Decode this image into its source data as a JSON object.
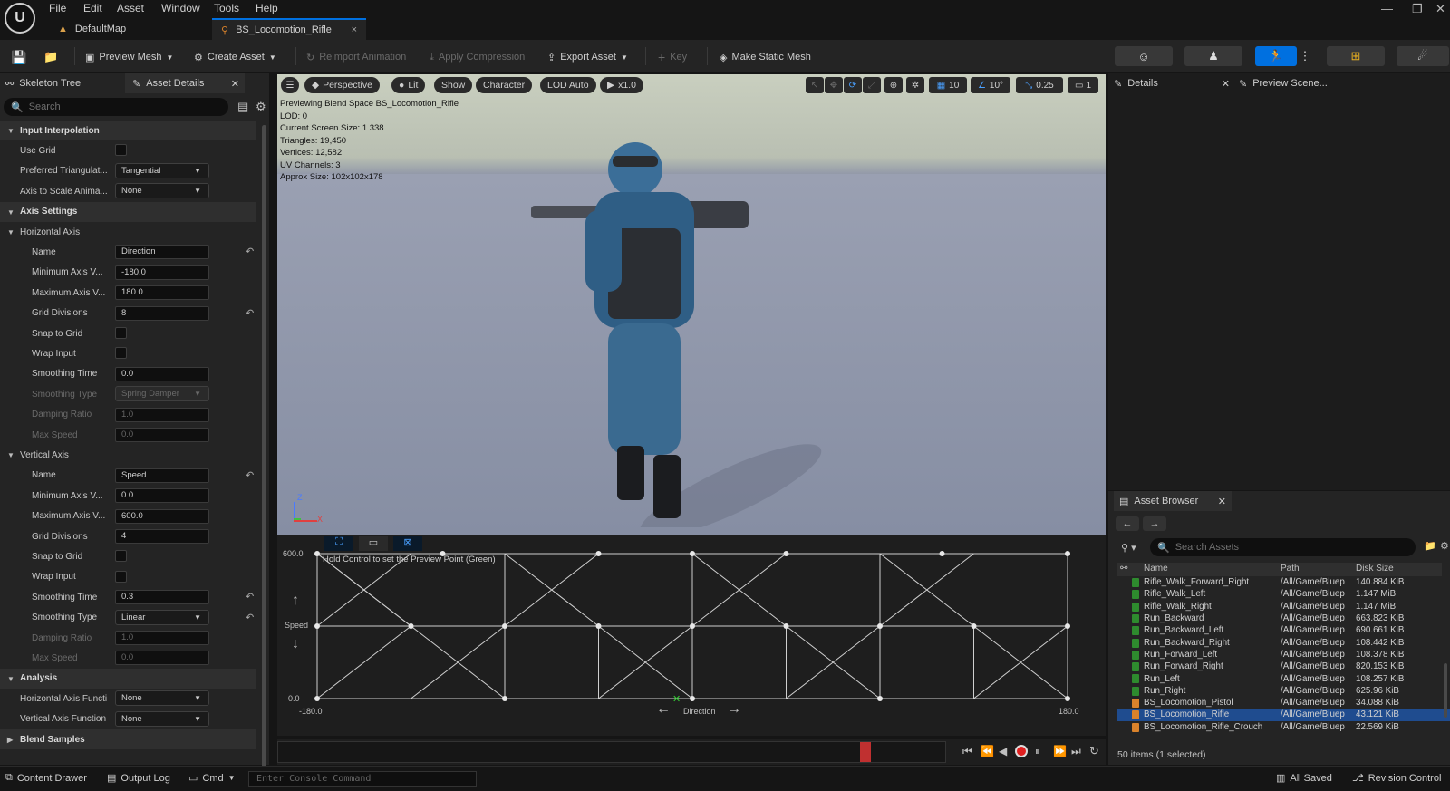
{
  "menu": {
    "items": [
      "File",
      "Edit",
      "Asset",
      "Window",
      "Tools",
      "Help"
    ]
  },
  "tabs": {
    "default_map": "DefaultMap",
    "active": "BS_Locomotion_Rifle",
    "close": "×"
  },
  "toolbar": {
    "preview_mesh": "Preview Mesh",
    "create_asset": "Create Asset",
    "reimport": "Reimport Animation",
    "apply_compression": "Apply Compression",
    "export_asset": "Export Asset",
    "key": "Key",
    "make_static_mesh": "Make Static Mesh"
  },
  "left_panel": {
    "tab_skeleton": "Skeleton Tree",
    "tab_asset_details": "Asset Details",
    "search_placeholder": "Search",
    "rows": [
      {
        "kind": "cat",
        "label": "Input Interpolation"
      },
      {
        "kind": "check",
        "label": "Use Grid"
      },
      {
        "kind": "dd",
        "label": "Preferred Triangulat...",
        "value": "Tangential"
      },
      {
        "kind": "dd",
        "label": "Axis to Scale Anima...",
        "value": "None"
      },
      {
        "kind": "cat",
        "label": "Axis Settings"
      },
      {
        "kind": "sub",
        "label": "Horizontal Axis"
      },
      {
        "kind": "text",
        "label": "Name",
        "value": "Direction",
        "reset": true
      },
      {
        "kind": "text",
        "label": "Minimum Axis V...",
        "value": "-180.0"
      },
      {
        "kind": "text",
        "label": "Maximum Axis V...",
        "value": "180.0"
      },
      {
        "kind": "text",
        "label": "Grid Divisions",
        "value": "8",
        "reset": true
      },
      {
        "kind": "check",
        "label": "Snap to Grid",
        "indent": true
      },
      {
        "kind": "check",
        "label": "Wrap Input",
        "indent": true
      },
      {
        "kind": "text",
        "label": "Smoothing Time",
        "value": "0.0"
      },
      {
        "kind": "dd",
        "label": "Smoothing Type",
        "value": "Spring Damper",
        "dim": true,
        "indent": true
      },
      {
        "kind": "text",
        "label": "Damping Ratio",
        "value": "1.0",
        "dim": true
      },
      {
        "kind": "text",
        "label": "Max Speed",
        "value": "0.0",
        "dim": true
      },
      {
        "kind": "sub",
        "label": "Vertical Axis"
      },
      {
        "kind": "text",
        "label": "Name",
        "value": "Speed",
        "reset": true
      },
      {
        "kind": "text",
        "label": "Minimum Axis V...",
        "value": "0.0"
      },
      {
        "kind": "text",
        "label": "Maximum Axis V...",
        "value": "600.0"
      },
      {
        "kind": "text",
        "label": "Grid Divisions",
        "value": "4"
      },
      {
        "kind": "check",
        "label": "Snap to Grid",
        "indent": true
      },
      {
        "kind": "check",
        "label": "Wrap Input",
        "indent": true
      },
      {
        "kind": "text",
        "label": "Smoothing Time",
        "value": "0.3",
        "reset": true
      },
      {
        "kind": "dd",
        "label": "Smoothing Type",
        "value": "Linear",
        "reset": true,
        "indent": true
      },
      {
        "kind": "text",
        "label": "Damping Ratio",
        "value": "1.0",
        "dim": true
      },
      {
        "kind": "text",
        "label": "Max Speed",
        "value": "0.0",
        "dim": true
      },
      {
        "kind": "cat",
        "label": "Analysis"
      },
      {
        "kind": "dd",
        "label": "Horizontal Axis Functi",
        "value": "None",
        "top": true
      },
      {
        "kind": "dd",
        "label": "Vertical Axis Function",
        "value": "None",
        "top": true
      },
      {
        "kind": "cat",
        "label": "Blend Samples",
        "collapsed": true
      }
    ]
  },
  "viewport": {
    "perspective": "Perspective",
    "lit": "Lit",
    "show": "Show",
    "character": "Character",
    "lod": "LOD Auto",
    "play_rate": "x1.0",
    "grid_snap": "10",
    "rot_snap": "10°",
    "scale_snap": "0.25",
    "cam_speed": "1",
    "stats": [
      "Previewing Blend Space BS_Locomotion_Rifle",
      "LOD: 0",
      "Current Screen Size: 1.338",
      "Triangles: 19,450",
      "Vertices: 12,582",
      "UV Channels: 3",
      "Approx Size: 102x102x178"
    ]
  },
  "blendspace": {
    "hint": "Hold Control to set the Preview Point (Green)",
    "y_max": "600.0",
    "y_min": "0.0",
    "x_min": "-180.0",
    "x_max": "180.0",
    "y_label": "Speed",
    "x_label": "Direction"
  },
  "timeline": {
    "progress": 0.88
  },
  "right_panel": {
    "tab_details": "Details",
    "tab_preview": "Preview Scene..."
  },
  "asset_browser": {
    "title": "Asset Browser",
    "search_placeholder": "Search Assets",
    "col_name": "Name",
    "col_path": "Path",
    "col_size": "Disk Size",
    "items": [
      {
        "name": "Rifle_Walk_Forward_Right",
        "path": "/All/Game/Bluep",
        "size": "140.884 KiB",
        "type": "anim"
      },
      {
        "name": "Rifle_Walk_Left",
        "path": "/All/Game/Bluep",
        "size": "1.147 MiB",
        "type": "anim"
      },
      {
        "name": "Rifle_Walk_Right",
        "path": "/All/Game/Bluep",
        "size": "1.147 MiB",
        "type": "anim"
      },
      {
        "name": "Run_Backward",
        "path": "/All/Game/Bluep",
        "size": "663.823 KiB",
        "type": "anim"
      },
      {
        "name": "Run_Backward_Left",
        "path": "/All/Game/Bluep",
        "size": "690.661 KiB",
        "type": "anim"
      },
      {
        "name": "Run_Backward_Right",
        "path": "/All/Game/Bluep",
        "size": "108.442 KiB",
        "type": "anim"
      },
      {
        "name": "Run_Forward_Left",
        "path": "/All/Game/Bluep",
        "size": "108.378 KiB",
        "type": "anim"
      },
      {
        "name": "Run_Forward_Right",
        "path": "/All/Game/Bluep",
        "size": "820.153 KiB",
        "type": "anim"
      },
      {
        "name": "Run_Left",
        "path": "/All/Game/Bluep",
        "size": "108.257 KiB",
        "type": "anim"
      },
      {
        "name": "Run_Right",
        "path": "/All/Game/Bluep",
        "size": "625.96 KiB",
        "type": "anim"
      },
      {
        "name": "BS_Locomotion_Pistol",
        "path": "/All/Game/Bluep",
        "size": "34.088 KiB",
        "type": "bs"
      },
      {
        "name": "BS_Locomotion_Rifle",
        "path": "/All/Game/Bluep",
        "size": "43.121 KiB",
        "type": "bs",
        "selected": true
      },
      {
        "name": "BS_Locomotion_Rifle_Crouch",
        "path": "/All/Game/Bluep",
        "size": "22.569 KiB",
        "type": "bs"
      }
    ],
    "footer": "50 items (1 selected)"
  },
  "status": {
    "content_drawer": "Content Drawer",
    "output_log": "Output Log",
    "cmd": "Cmd",
    "console_placeholder": "Enter Console Command",
    "all_saved": "All Saved",
    "revision_control": "Revision Control"
  },
  "colors": {
    "accent": "#0070e0",
    "selected_row": "#1f4c8f",
    "anim_icon": "#2e8b2e",
    "bs_icon": "#d9822b",
    "record": "#e02020"
  }
}
